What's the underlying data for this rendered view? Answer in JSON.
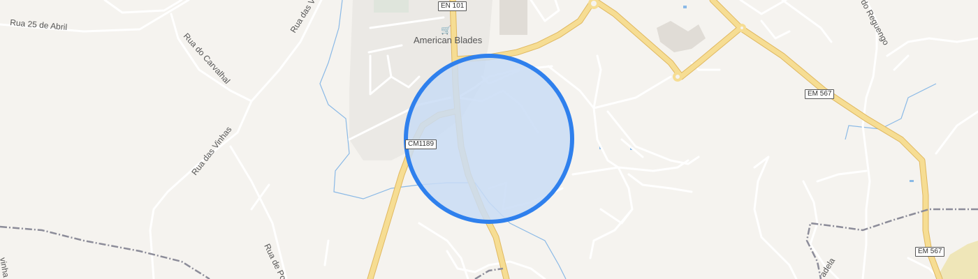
{
  "map": {
    "street_labels": {
      "rua_25_abril": "Rua 25 de Abril",
      "rua_carvalhal": "Rua do Carvalhal",
      "rua_vinhas_1": "Rua das Vi",
      "rua_vinhas_2": "Rua das Vinhas",
      "rua_po": "Rua de Po",
      "rua_reguengo": "do Reguengo",
      "vinha": "vinha",
      "adela": "adela"
    },
    "road_shields": {
      "en101": "EN 101",
      "cm1189": "CM1189",
      "em567_a": "EM 567",
      "em567_b": "EM 567"
    },
    "poi": {
      "name": "American Blades",
      "icon": "shopping-basket-icon"
    },
    "location_circle": {
      "fill": "#cddff5",
      "stroke": "#2f80ed"
    },
    "colors": {
      "background": "#f5f3ef",
      "major_road": "#f5d98a",
      "minor_road": "#ffffff",
      "water": "#8ab9e6",
      "railway": "#8c8c99"
    }
  }
}
